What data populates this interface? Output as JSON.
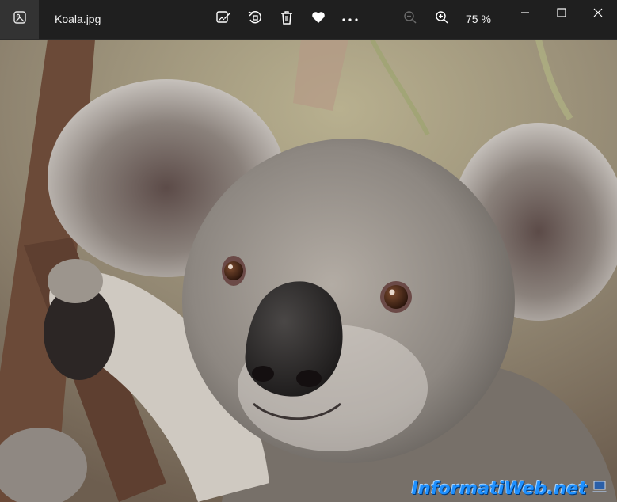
{
  "app": {
    "file_name": "Koala.jpg"
  },
  "toolbar": {
    "icons": [
      "edit-image-icon",
      "rotate-icon",
      "delete-icon",
      "favorite-icon",
      "more-icon"
    ],
    "zoom_level": "75 %"
  },
  "window_controls": [
    "minimize-icon",
    "maximize-icon",
    "close-icon"
  ],
  "photo": {
    "subject": "koala",
    "watermark_text": "InformatiWeb.net"
  },
  "colors": {
    "titlebar": "#1f1f1f",
    "watermark": "#1e90ff"
  }
}
